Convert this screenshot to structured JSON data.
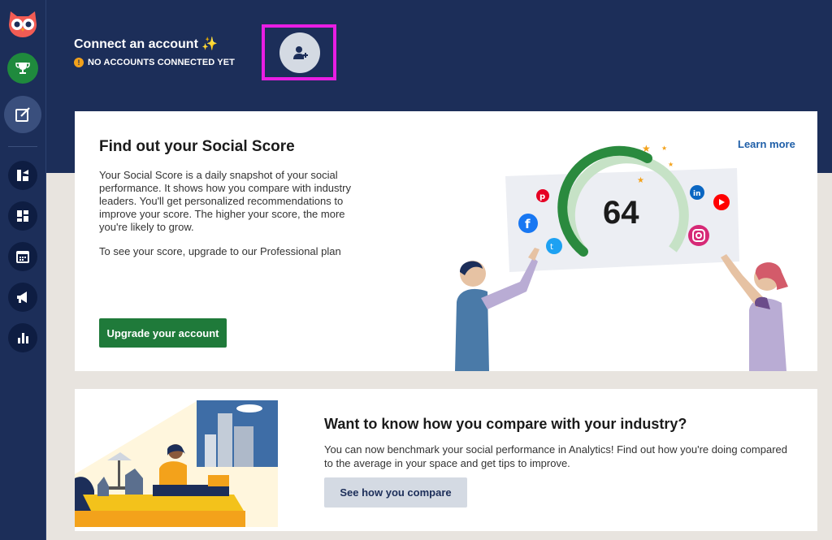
{
  "sidebar": {
    "items": [
      {
        "name": "owl-logo-icon"
      },
      {
        "name": "trophy-icon"
      },
      {
        "name": "compose-icon"
      },
      {
        "name": "streams-icon"
      },
      {
        "name": "dashboard-icon"
      },
      {
        "name": "calendar-icon"
      },
      {
        "name": "megaphone-icon"
      },
      {
        "name": "analytics-icon"
      }
    ]
  },
  "header": {
    "title": "Connect an account ✨",
    "status_icon": "!",
    "status": "NO ACCOUNTS CONNECTED YET"
  },
  "social_score": {
    "title": "Find out your Social Score",
    "body": "Your Social Score is a daily snapshot of your social performance. It shows how you compare with industry leaders. You'll get personalized recommendations to improve your score. The higher your score, the more you're likely to grow.",
    "upgrade_note": "To see your score, upgrade to our Professional plan",
    "upgrade_button": "Upgrade your account",
    "learn_more": "Learn more",
    "score": "64"
  },
  "industry": {
    "title": "Want to know how you compare with your industry?",
    "body": "You can now benchmark your social performance in Analytics! Find out how you're doing compared to the average in your space and get tips to improve.",
    "button": "See how you compare"
  },
  "colors": {
    "nav_bg": "#1c2e59",
    "accent_green": "#1f7a3a",
    "highlight": "#e81ee3",
    "link_blue": "#1f5fa8"
  }
}
